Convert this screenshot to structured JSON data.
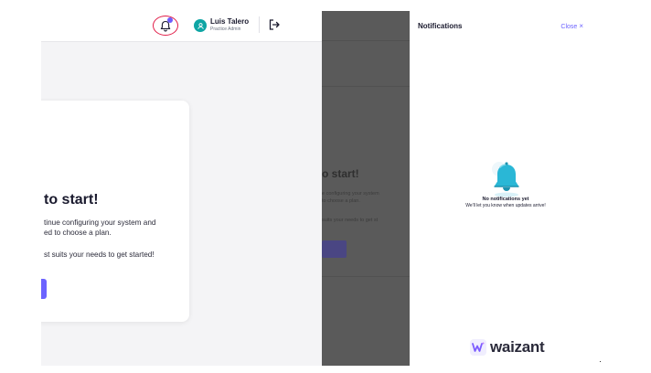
{
  "header": {
    "user_name": "Luis Talero",
    "user_role": "Practice Admin",
    "notifications_badge_color": "#6d5dfc",
    "icons": [
      "bell-icon",
      "user-icon",
      "logout-icon"
    ]
  },
  "card": {
    "title": "to start!",
    "line1": "tinue configuring your system and",
    "line2": "ed to choose a plan.",
    "line3": "st suits your needs to get started!",
    "button_color": "#6c63ff"
  },
  "overlay": {
    "title": "o start!",
    "line1": "e configuring your system",
    "line2": "to choose a plan.",
    "line3": "suits your needs to get st"
  },
  "drawer": {
    "title": "Notifications",
    "close_label": "Close",
    "close_icon": "×",
    "empty_title": "No notifications yet",
    "empty_subtitle": "We'll let you know when updates arrive!",
    "brand_name": "waizant",
    "accent": "#6c63ff"
  }
}
